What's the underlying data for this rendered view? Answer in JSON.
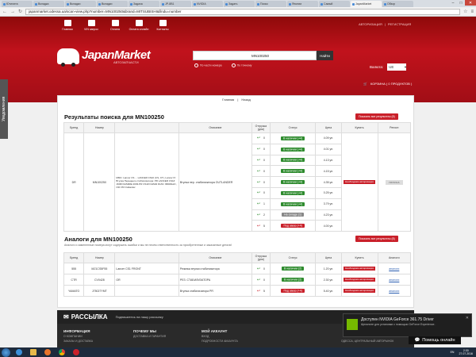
{
  "browser": {
    "tabs": [
      "Ютилита",
      "Вкладка",
      "Вкладки",
      "Вкладки",
      "Задача",
      "JP-8B1",
      "NVIDIA",
      "Задать",
      "Поиск",
      "Японии",
      "Самый",
      "JapanMarket",
      "Обзор"
    ],
    "url": "japanmarket.odessa.ua/scan-view.php?number=MN100250&brand=MITSUBISHI&findu=number"
  },
  "site": {
    "topnav": [
      "Главная",
      "VIN запрос",
      "Оплата",
      "Оплата онлайн",
      "Контакты"
    ],
    "auth_login": "АВТОРИЗАЦИЯ",
    "auth_sep": "|",
    "auth_register": "РЕГИСТРАЦИЯ",
    "logo_text": "JapanMarket",
    "logo_sub": "АВТОЗАПЧАСТИ",
    "search_value": "MN100250",
    "search_button": "Найти",
    "radio_number": "По части номера",
    "radio_exact": "По точному",
    "currency_label": "Валюта:",
    "currency_value": "UE",
    "cart_label": "КОРЗИНА ( 0 ПРОДУКТОВ )"
  },
  "breadcrumb": {
    "home": "Главная",
    "sep": "|",
    "back": "Назад"
  },
  "results": {
    "title": "Результаты поиска для MN100250",
    "show_all": "Показать все результаты (8)",
    "headers": [
      "Бренд",
      "Номер",
      "",
      "Описание",
      "Отгрузка (дни)",
      "Статус",
      "Цена",
      "Купить",
      "Регион"
    ],
    "brand": "DR",
    "number": "MN100250",
    "info": "MMC: Lancer CS ... LANCER CS10 (CS, CT), Lancer IX Втулка Переднего стабилизатора: PR LANCER CS1# 160Ф DHS0RE 2003-PR CS1# DHS02 DHS= ФФ2Фм4=, ОЯ: PR Outlander",
    "desc": "Втулка пер. стабилизатора OUTLANDER",
    "ask_price": "Необходимо авторизация",
    "region": "УКРАИНА",
    "rows": [
      {
        "days": "0",
        "status": "В наличии (+4)",
        "price": "4.09 уе."
      },
      {
        "days": "0",
        "status": "В наличии (+4)",
        "price": "4.01 уе."
      },
      {
        "days": "0",
        "status": "В наличии (+4)",
        "price": "4.13 уе."
      },
      {
        "days": "0",
        "status": "В наличии (+4)",
        "price": "4.15 уе."
      },
      {
        "days": "0",
        "status": "В наличии (+4)",
        "price": "4.35 уе."
      },
      {
        "days": "0",
        "status": "В наличии (+4)",
        "price": "0.25 уе."
      },
      {
        "days": "1",
        "status": "В наличии (+4)",
        "price": "3.79 уе."
      },
      {
        "days": "2",
        "status": "На складе (1)",
        "price": "4.23 уе."
      },
      {
        "days": "5",
        "status": "Под заказ (+4)",
        "price": "4.00 уе."
      }
    ]
  },
  "analogs": {
    "title": "Аналоги для MN100250",
    "show_all": "Показать все результаты (8)",
    "note": "Аналоги и замененные номера могут содержать ошибки и мы не несем ответственность за приобретенные и заказанные детали!",
    "headers": [
      "Бренд",
      "Номер",
      "",
      "Описание",
      "Отгрузка (дни)",
      "Статус",
      "Цена",
      "Купить",
      "Аналоги"
    ],
    "rows": [
      {
        "brand": "555",
        "number": "MZ1CS5F55",
        "info": "Lancer CS1 FRONT",
        "desc": "Резинка втулки стабилизатора",
        "days": "0",
        "status": "В наличии (2)",
        "price": "1.20 уе.",
        "analog": "аналоги"
      },
      {
        "brand": "CTR",
        "number": "CV0428",
        "info": "OR",
        "desc": "РЕЗ. СТАБИЛИЗАТОРА",
        "days": "0",
        "status": "В наличии (2)",
        "price": "2.30 уе.",
        "analog": "аналоги"
      },
      {
        "brand": "YAMATO",
        "number": "J75027YMT",
        "info": "",
        "desc": "Втулка стабилизатора PR",
        "days": "5",
        "status": "Под заказ (+4)",
        "price": "5.40 уе.",
        "analog": "аналоги"
      }
    ],
    "ask_price": "Необходимо авторизация"
  },
  "newsletter": {
    "title": "РАССЫЛКА",
    "subtitle": "Подпишитесь на нашу рассылку"
  },
  "footer": {
    "col1_title": "ИНФОРМАЦИЯ",
    "col1_items": [
      "О КОМПАНИИ",
      "ЗАКАЗЫ И ДОСТАВКА"
    ],
    "col2_title": "ПОЧЕМУ МЫ",
    "col2_items": [
      "ДОСТАВКА И ГАРАНТИЯ"
    ],
    "col3_title": "МОЙ АККАУНТ",
    "col3_items": [
      "ВХОД",
      "ПОДРОБНОСТИ АККАУНТА"
    ],
    "address": "ОДЕССА, ЦЕНТРАЛЬНЫЙ АВТОРЫНОК"
  },
  "feedback_tab": "Уведомления",
  "notification": {
    "title": "Доступен NVIDIA GeForce 361.75 Driver",
    "body": "Щелкните для установки с помощью GeForce Experience."
  },
  "help_button": "Помощь онлайн",
  "taskbar": {
    "lang": "EN",
    "time": "2:30",
    "date": "27.07.2016"
  }
}
